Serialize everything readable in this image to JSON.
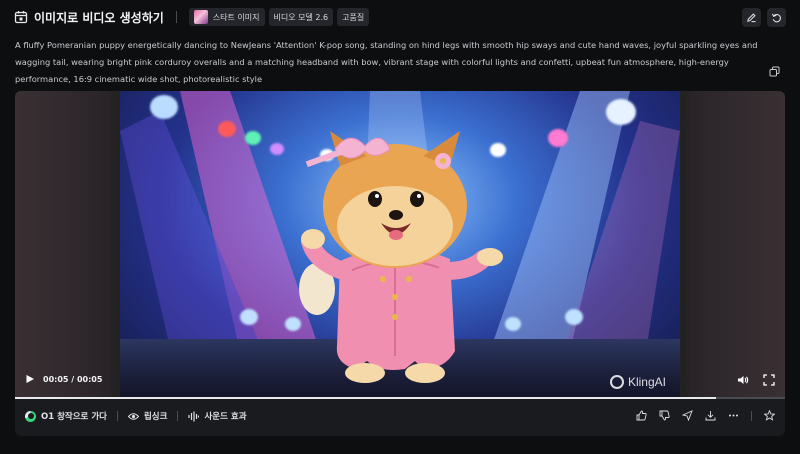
{
  "header": {
    "title": "이미지로 비디오 생성하기",
    "title_icon": "calendar-icon",
    "chips": [
      {
        "label": "스타트 이미지",
        "has_thumb": true
      },
      {
        "label": "비디오 모델 2.6",
        "has_thumb": false
      },
      {
        "label": "고품질",
        "has_thumb": false
      }
    ],
    "right_icons": [
      "edit-icon",
      "undo-icon"
    ]
  },
  "prompt": {
    "text": "A fluffy Pomeranian puppy energetically dancing to NewJeans 'Attention' K-pop song, standing on hind legs with smooth hip sways and cute hand waves, joyful sparkling eyes and wagging tail, wearing bright pink corduroy overalls and a matching headband with bow, vibrant stage with colorful lights and confetti, upbeat fun atmosphere, high-energy performance, 16:9 cinematic wide shot, photorealistic style",
    "copy_icon": "copy-icon"
  },
  "video": {
    "time": "00:05 / 00:05",
    "progress": 0.91,
    "watermark": "KlingAI",
    "icons": [
      "play-icon",
      "volume-icon",
      "fullscreen-icon"
    ]
  },
  "actions": {
    "items": [
      {
        "label": "O1 창작으로 가다",
        "icon": "o1-icon"
      },
      {
        "label": "립싱크",
        "icon": "eye-icon"
      },
      {
        "label": "사운드 효과",
        "icon": "sound-icon"
      }
    ],
    "right_icons": [
      "thumbs-up-icon",
      "thumbs-down-icon",
      "send-icon",
      "download-icon",
      "more-icon",
      "star-icon"
    ]
  },
  "colors": {
    "background": "#0d0e10",
    "card": "#1a1b1f",
    "chip": "#24262b",
    "accent_green": "#37d67a"
  }
}
